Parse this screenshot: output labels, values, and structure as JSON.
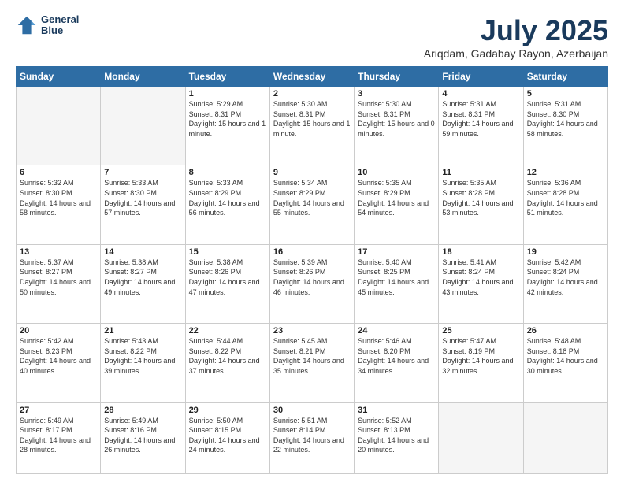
{
  "header": {
    "logo_line1": "General",
    "logo_line2": "Blue",
    "title": "July 2025",
    "subtitle": "Ariqdam, Gadabay Rayon, Azerbaijan"
  },
  "weekdays": [
    "Sunday",
    "Monday",
    "Tuesday",
    "Wednesday",
    "Thursday",
    "Friday",
    "Saturday"
  ],
  "weeks": [
    [
      {
        "day": "",
        "detail": ""
      },
      {
        "day": "",
        "detail": ""
      },
      {
        "day": "1",
        "detail": "Sunrise: 5:29 AM\nSunset: 8:31 PM\nDaylight: 15 hours\nand 1 minute."
      },
      {
        "day": "2",
        "detail": "Sunrise: 5:30 AM\nSunset: 8:31 PM\nDaylight: 15 hours\nand 1 minute."
      },
      {
        "day": "3",
        "detail": "Sunrise: 5:30 AM\nSunset: 8:31 PM\nDaylight: 15 hours\nand 0 minutes."
      },
      {
        "day": "4",
        "detail": "Sunrise: 5:31 AM\nSunset: 8:31 PM\nDaylight: 14 hours\nand 59 minutes."
      },
      {
        "day": "5",
        "detail": "Sunrise: 5:31 AM\nSunset: 8:30 PM\nDaylight: 14 hours\nand 58 minutes."
      }
    ],
    [
      {
        "day": "6",
        "detail": "Sunrise: 5:32 AM\nSunset: 8:30 PM\nDaylight: 14 hours\nand 58 minutes."
      },
      {
        "day": "7",
        "detail": "Sunrise: 5:33 AM\nSunset: 8:30 PM\nDaylight: 14 hours\nand 57 minutes."
      },
      {
        "day": "8",
        "detail": "Sunrise: 5:33 AM\nSunset: 8:29 PM\nDaylight: 14 hours\nand 56 minutes."
      },
      {
        "day": "9",
        "detail": "Sunrise: 5:34 AM\nSunset: 8:29 PM\nDaylight: 14 hours\nand 55 minutes."
      },
      {
        "day": "10",
        "detail": "Sunrise: 5:35 AM\nSunset: 8:29 PM\nDaylight: 14 hours\nand 54 minutes."
      },
      {
        "day": "11",
        "detail": "Sunrise: 5:35 AM\nSunset: 8:28 PM\nDaylight: 14 hours\nand 53 minutes."
      },
      {
        "day": "12",
        "detail": "Sunrise: 5:36 AM\nSunset: 8:28 PM\nDaylight: 14 hours\nand 51 minutes."
      }
    ],
    [
      {
        "day": "13",
        "detail": "Sunrise: 5:37 AM\nSunset: 8:27 PM\nDaylight: 14 hours\nand 50 minutes."
      },
      {
        "day": "14",
        "detail": "Sunrise: 5:38 AM\nSunset: 8:27 PM\nDaylight: 14 hours\nand 49 minutes."
      },
      {
        "day": "15",
        "detail": "Sunrise: 5:38 AM\nSunset: 8:26 PM\nDaylight: 14 hours\nand 47 minutes."
      },
      {
        "day": "16",
        "detail": "Sunrise: 5:39 AM\nSunset: 8:26 PM\nDaylight: 14 hours\nand 46 minutes."
      },
      {
        "day": "17",
        "detail": "Sunrise: 5:40 AM\nSunset: 8:25 PM\nDaylight: 14 hours\nand 45 minutes."
      },
      {
        "day": "18",
        "detail": "Sunrise: 5:41 AM\nSunset: 8:24 PM\nDaylight: 14 hours\nand 43 minutes."
      },
      {
        "day": "19",
        "detail": "Sunrise: 5:42 AM\nSunset: 8:24 PM\nDaylight: 14 hours\nand 42 minutes."
      }
    ],
    [
      {
        "day": "20",
        "detail": "Sunrise: 5:42 AM\nSunset: 8:23 PM\nDaylight: 14 hours\nand 40 minutes."
      },
      {
        "day": "21",
        "detail": "Sunrise: 5:43 AM\nSunset: 8:22 PM\nDaylight: 14 hours\nand 39 minutes."
      },
      {
        "day": "22",
        "detail": "Sunrise: 5:44 AM\nSunset: 8:22 PM\nDaylight: 14 hours\nand 37 minutes."
      },
      {
        "day": "23",
        "detail": "Sunrise: 5:45 AM\nSunset: 8:21 PM\nDaylight: 14 hours\nand 35 minutes."
      },
      {
        "day": "24",
        "detail": "Sunrise: 5:46 AM\nSunset: 8:20 PM\nDaylight: 14 hours\nand 34 minutes."
      },
      {
        "day": "25",
        "detail": "Sunrise: 5:47 AM\nSunset: 8:19 PM\nDaylight: 14 hours\nand 32 minutes."
      },
      {
        "day": "26",
        "detail": "Sunrise: 5:48 AM\nSunset: 8:18 PM\nDaylight: 14 hours\nand 30 minutes."
      }
    ],
    [
      {
        "day": "27",
        "detail": "Sunrise: 5:49 AM\nSunset: 8:17 PM\nDaylight: 14 hours\nand 28 minutes."
      },
      {
        "day": "28",
        "detail": "Sunrise: 5:49 AM\nSunset: 8:16 PM\nDaylight: 14 hours\nand 26 minutes."
      },
      {
        "day": "29",
        "detail": "Sunrise: 5:50 AM\nSunset: 8:15 PM\nDaylight: 14 hours\nand 24 minutes."
      },
      {
        "day": "30",
        "detail": "Sunrise: 5:51 AM\nSunset: 8:14 PM\nDaylight: 14 hours\nand 22 minutes."
      },
      {
        "day": "31",
        "detail": "Sunrise: 5:52 AM\nSunset: 8:13 PM\nDaylight: 14 hours\nand 20 minutes."
      },
      {
        "day": "",
        "detail": ""
      },
      {
        "day": "",
        "detail": ""
      }
    ]
  ]
}
